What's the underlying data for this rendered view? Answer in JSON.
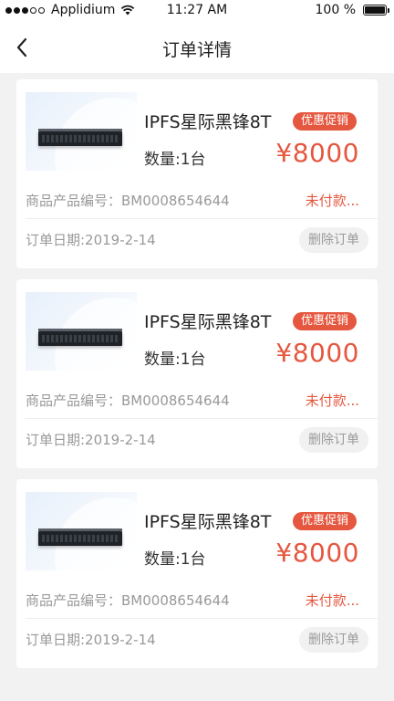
{
  "status_bar": {
    "carrier": "Applidium",
    "time": "11:27 AM",
    "battery": "100 %",
    "battery_level": 1.0
  },
  "header": {
    "title": "订单详情",
    "back_icon": "chevron-left-icon"
  },
  "orders": [
    {
      "product_name": "IPFS星际黑锋8T",
      "badge": "优惠促销",
      "quantity": "数量:1台",
      "price": "¥8000",
      "product_code": "商品产品编号：BM0008654644",
      "status": "未付款...",
      "order_date": "订单日期:2019-2-14",
      "delete_label": "删除订单"
    },
    {
      "product_name": "IPFS星际黑锋8T",
      "badge": "优惠促销",
      "quantity": "数量:1台",
      "price": "¥8000",
      "product_code": "商品产品编号：BM0008654644",
      "status": "未付款...",
      "order_date": "订单日期:2019-2-14",
      "delete_label": "删除订单"
    },
    {
      "product_name": "IPFS星际黑锋8T",
      "badge": "优惠促销",
      "quantity": "数量:1台",
      "price": "¥8000",
      "product_code": "商品产品编号：BM0008654644",
      "status": "未付款...",
      "order_date": "订单日期:2019-2-14",
      "delete_label": "删除订单"
    }
  ],
  "colors": {
    "accent": "#e5573f",
    "background": "#f2f2f2",
    "muted_text": "#999999"
  }
}
